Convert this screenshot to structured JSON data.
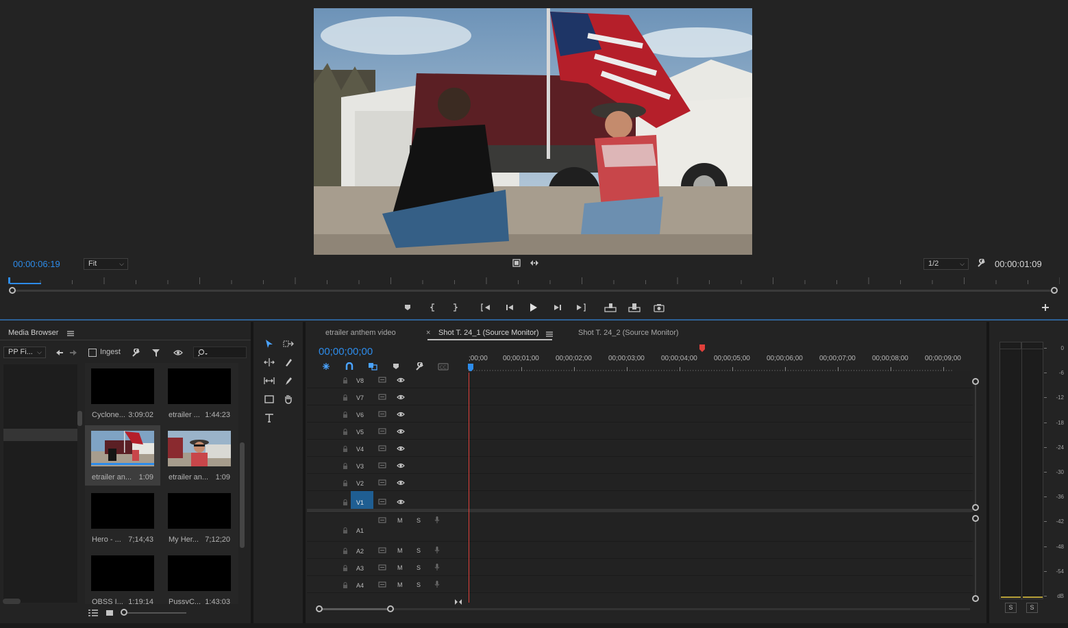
{
  "source_monitor": {
    "current_timecode": "00:00:06:19",
    "zoom": "Fit",
    "resolution": "1/2",
    "duration": "00:00:01:09",
    "playhead_fraction": 0.03,
    "transport_buttons": [
      "add-marker",
      "mark-in",
      "mark-out",
      "go-to-in",
      "step-back",
      "play",
      "step-forward",
      "go-to-out",
      "insert",
      "overwrite",
      "export-frame"
    ]
  },
  "media_browser": {
    "title": "Media Browser",
    "path": "PP Fi...",
    "ingest_label": "Ingest",
    "items": [
      {
        "name": "Cyclone...",
        "duration": "3:09:02",
        "thumb": "black"
      },
      {
        "name": "etrailer ...",
        "duration": "1:44:23",
        "thumb": "black"
      },
      {
        "name": "etrailer an...",
        "duration": "1:09",
        "thumb": "scene-flag",
        "selected": true
      },
      {
        "name": "etrailer an...",
        "duration": "1:09",
        "thumb": "scene-cowboy"
      },
      {
        "name": "Hero - ...",
        "duration": "7;14;43",
        "thumb": "black"
      },
      {
        "name": "My Her...",
        "duration": "7;12;20",
        "thumb": "black"
      },
      {
        "name": "OBSS I...",
        "duration": "1:19:14",
        "thumb": "black"
      },
      {
        "name": "PussyC...",
        "duration": "1:43:03",
        "thumb": "black"
      }
    ]
  },
  "timeline": {
    "tabs": [
      {
        "label": "etrailer anthem video",
        "active": false
      },
      {
        "label": "Shot T. 24_1 (Source Monitor)",
        "active": true
      },
      {
        "label": "Shot T. 24_2 (Source Monitor)",
        "active": false
      }
    ],
    "timecode": "00;00;00;00",
    "ruler": [
      ";00;00",
      "00;00;01;00",
      "00;00;02;00",
      "00;00;03;00",
      "00;00;04;00",
      "00;00;05;00",
      "00;00;06;00",
      "00;00;07;00",
      "00;00;08;00",
      "00;00;09;00"
    ],
    "video_tracks": [
      "V8",
      "V7",
      "V6",
      "V5",
      "V4",
      "V3",
      "V2",
      "V1"
    ],
    "audio_tracks": [
      "A1",
      "A2",
      "A3",
      "A4"
    ],
    "mute_label": "M",
    "solo_label": "S"
  },
  "meters": {
    "scale": [
      "0",
      "-6",
      "-12",
      "-18",
      "-24",
      "-30",
      "-36",
      "-42",
      "-48",
      "-54",
      "dB"
    ],
    "solo_labels": [
      "S",
      "S"
    ]
  },
  "colors": {
    "accent_blue": "#2d8ceb",
    "playhead_red": "#e0403a",
    "panel_bg": "#232323",
    "selected_track": "#1f5e92"
  }
}
